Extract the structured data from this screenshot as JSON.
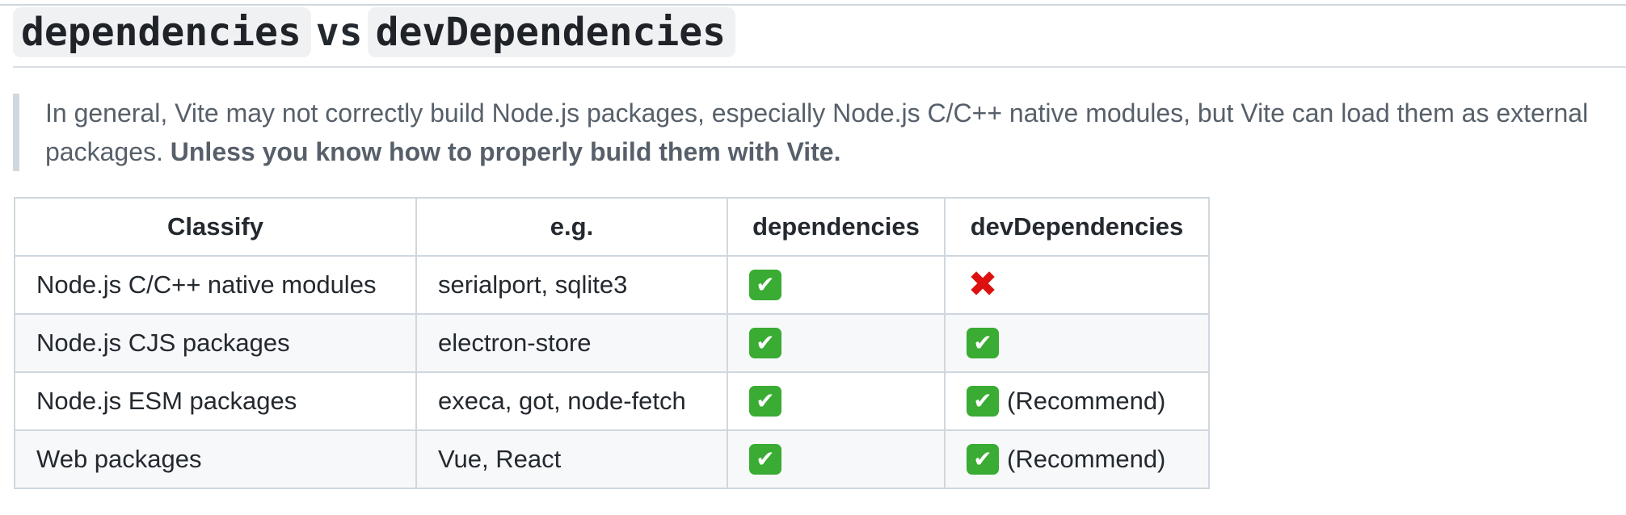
{
  "heading": {
    "left_code": "dependencies",
    "middle": "vs",
    "right_code": "devDependencies"
  },
  "note": {
    "text": "In general, Vite may not correctly build Node.js packages, especially Node.js C/C++ native modules, but Vite can load them as external packages.",
    "bold": "Unless you know how to properly build them with Vite."
  },
  "table": {
    "headers": [
      "Classify",
      "e.g.",
      "dependencies",
      "devDependencies"
    ],
    "rows": [
      {
        "classify": "Node.js C/C++ native modules",
        "eg": "serialport, sqlite3",
        "dependencies": "check-icon",
        "devDependencies": "cross-icon",
        "dev_note": ""
      },
      {
        "classify": "Node.js CJS packages",
        "eg": "electron-store",
        "dependencies": "check-icon",
        "devDependencies": "check-icon",
        "dev_note": ""
      },
      {
        "classify": "Node.js ESM packages",
        "eg": "execa, got, node-fetch",
        "dependencies": "check-icon",
        "devDependencies": "check-icon",
        "dev_note": "(Recommend)"
      },
      {
        "classify": "Web packages",
        "eg": "Vue, React",
        "dependencies": "check-icon",
        "devDependencies": "check-icon",
        "dev_note": "(Recommend)"
      }
    ]
  },
  "icons": {
    "check": "✔",
    "cross": "✖"
  },
  "colors": {
    "check_bg": "#3aab33",
    "cross": "#dd1010",
    "text": "#24292f",
    "muted": "#57606a"
  }
}
